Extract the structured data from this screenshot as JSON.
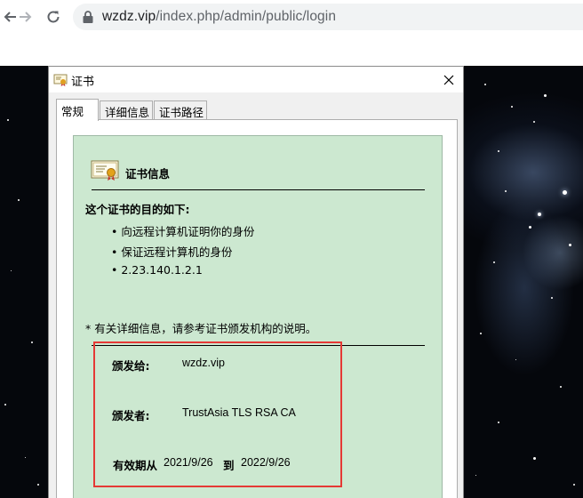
{
  "browser": {
    "url_host": "wzdz.vip",
    "url_path": "/index.php/admin/public/login"
  },
  "dialog": {
    "title": "证书",
    "tabs": [
      {
        "label": "常规",
        "active": true
      },
      {
        "label": "详细信息",
        "active": false
      },
      {
        "label": "证书路径",
        "active": false
      }
    ],
    "cert_info_heading": "证书信息",
    "purpose_title": "这个证书的目的如下:",
    "purposes": [
      "• 向远程计算机证明你的身份",
      "• 保证远程计算机的身份",
      "• 2.23.140.1.2.1"
    ],
    "note": "* 有关详细信息，请参考证书颁发机构的说明。",
    "issued_to_label": "颁发给:",
    "issued_to_value": "wzdz.vip",
    "issued_by_label": "颁发者:",
    "issued_by_value": "TrustAsia TLS RSA CA",
    "valid_from_label": "有效期从",
    "valid_from_value": "2021/9/26",
    "valid_to_label": "到",
    "valid_to_value": "2022/9/26"
  },
  "colors": {
    "cert_background": "#cce8d0",
    "highlight_frame": "#e53935"
  }
}
